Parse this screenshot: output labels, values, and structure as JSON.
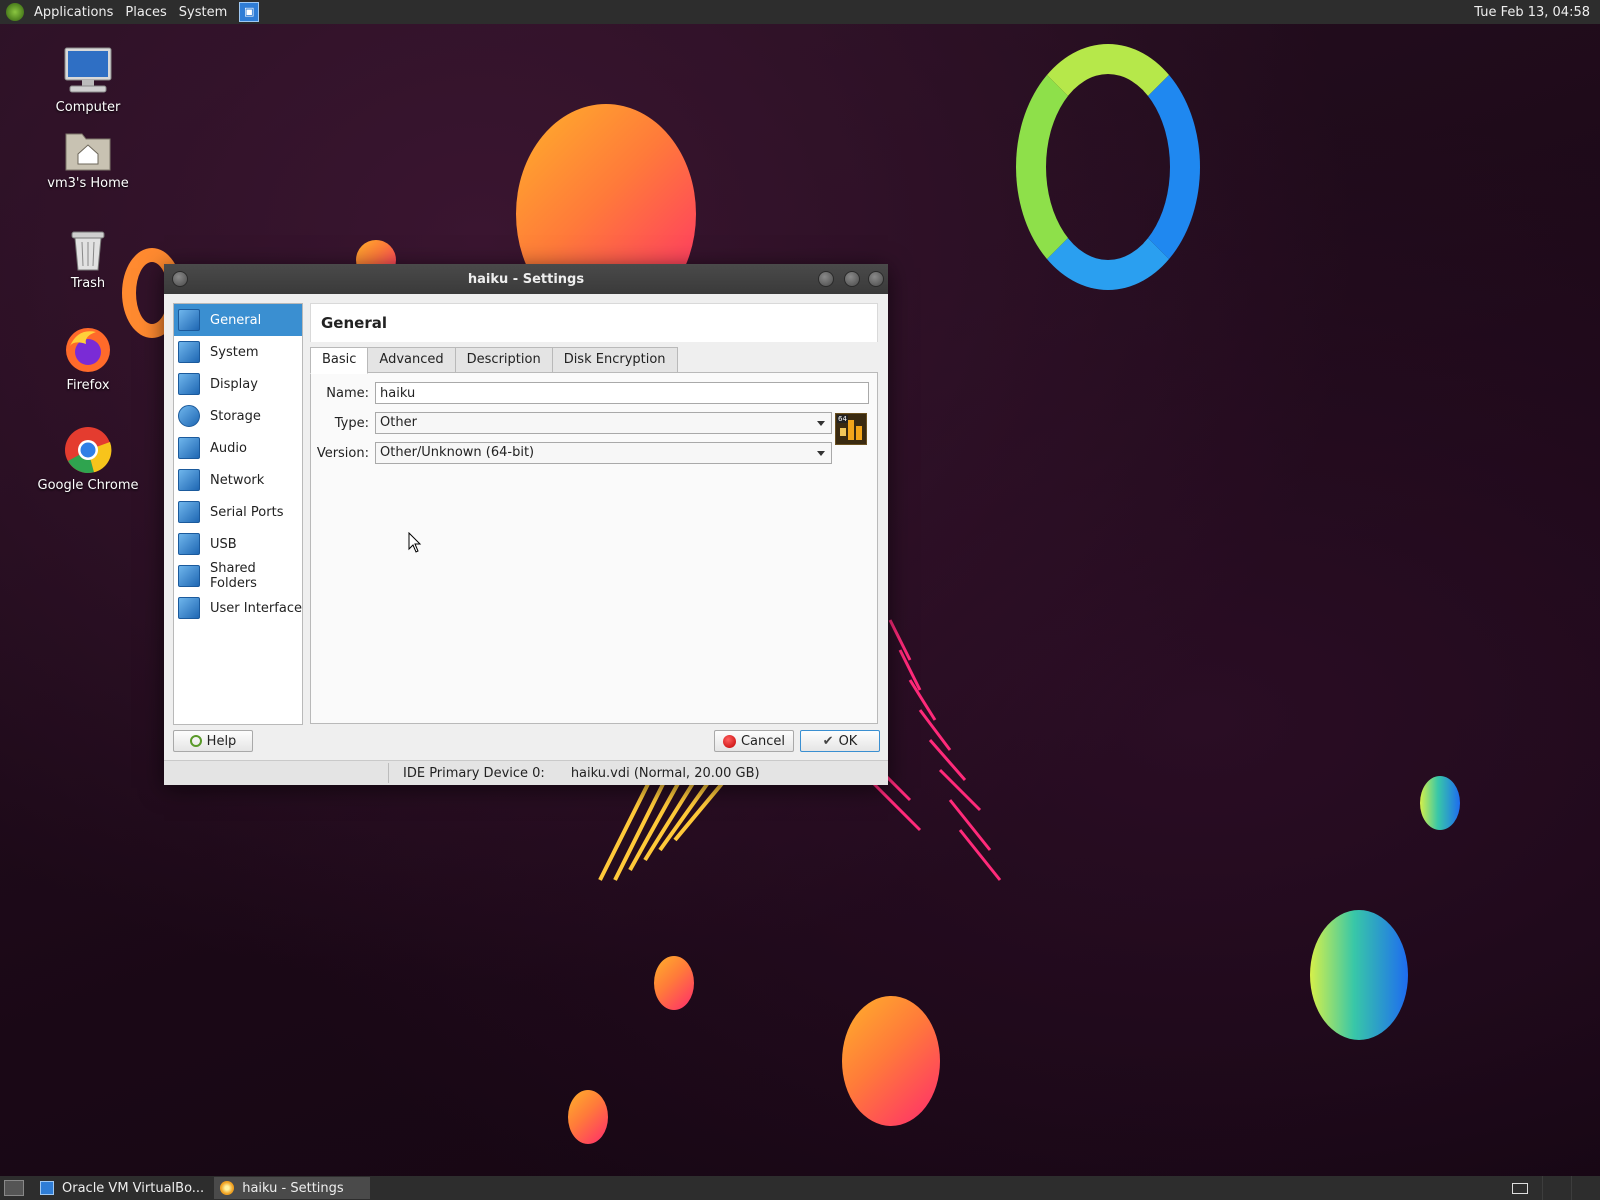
{
  "top_panel": {
    "menus": [
      "Applications",
      "Places",
      "System"
    ],
    "clock": "Tue Feb 13, 04:58"
  },
  "desktop": {
    "icons": [
      {
        "label": "Computer",
        "icon": "computer-icon"
      },
      {
        "label": "vm3's Home",
        "icon": "home-folder-icon"
      },
      {
        "label": "Trash",
        "icon": "trash-icon"
      },
      {
        "label": "Firefox",
        "icon": "firefox-icon"
      },
      {
        "label": "Google Chrome",
        "icon": "chrome-icon"
      }
    ]
  },
  "dialog": {
    "title": "haiku - Settings",
    "sidebar": [
      {
        "label": "General",
        "icon": "general-icon",
        "active": true
      },
      {
        "label": "System",
        "icon": "system-chip-icon"
      },
      {
        "label": "Display",
        "icon": "display-icon"
      },
      {
        "label": "Storage",
        "icon": "storage-icon"
      },
      {
        "label": "Audio",
        "icon": "audio-icon"
      },
      {
        "label": "Network",
        "icon": "network-icon"
      },
      {
        "label": "Serial Ports",
        "icon": "serial-ports-icon"
      },
      {
        "label": "USB",
        "icon": "usb-icon"
      },
      {
        "label": "Shared Folders",
        "icon": "shared-folders-icon"
      },
      {
        "label": "User Interface",
        "icon": "user-interface-icon"
      }
    ],
    "page_title": "General",
    "tabs": [
      {
        "label": "Basic",
        "active": true
      },
      {
        "label": "Advanced"
      },
      {
        "label": "Description"
      },
      {
        "label": "Disk Encryption"
      }
    ],
    "form": {
      "name_label": "Name:",
      "name_value": "haiku",
      "type_label": "Type:",
      "type_value": "Other",
      "version_label": "Version:",
      "version_value": "Other/Unknown (64-bit)",
      "os_badge": "64"
    },
    "buttons": {
      "help": "Help",
      "cancel": "Cancel",
      "ok": "OK"
    },
    "statusbar": {
      "device": "IDE Primary Device 0:",
      "disk": "haiku.vdi (Normal, 20.00 GB)"
    }
  },
  "taskbar": {
    "tasks": [
      {
        "label": "Oracle VM VirtualBo...",
        "icon": "virtualbox-icon"
      },
      {
        "label": "haiku - Settings",
        "icon": "settings-gear-icon",
        "active": true
      }
    ]
  },
  "colors": {
    "accent": "#3a8fd1",
    "panel": "#2d2d2d",
    "dialog_bg": "#efefef"
  }
}
